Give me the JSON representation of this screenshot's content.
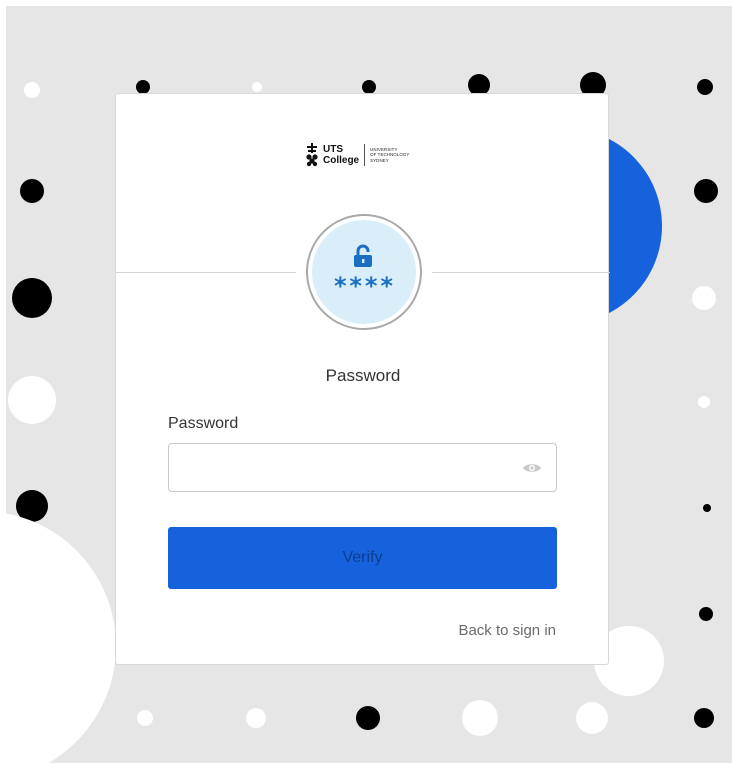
{
  "brand": {
    "name_line1": "UTS",
    "name_line2": "College",
    "university_line1": "UNIVERSITY",
    "university_line2": "OF TECHNOLOGY",
    "university_line3": "SYDNEY"
  },
  "auth_icon": {
    "icon": "unlock-icon",
    "masked_text": "****"
  },
  "form": {
    "title": "Password",
    "password_label": "Password",
    "password_value": "",
    "toggle_icon": "eye-icon",
    "verify_label": "Verify",
    "back_link": "Back to sign in"
  },
  "colors": {
    "primary": "#1662dd",
    "icon_blue": "#1b6fc2",
    "icon_bg": "#daeef9",
    "page_bg": "#e6e6e6"
  }
}
